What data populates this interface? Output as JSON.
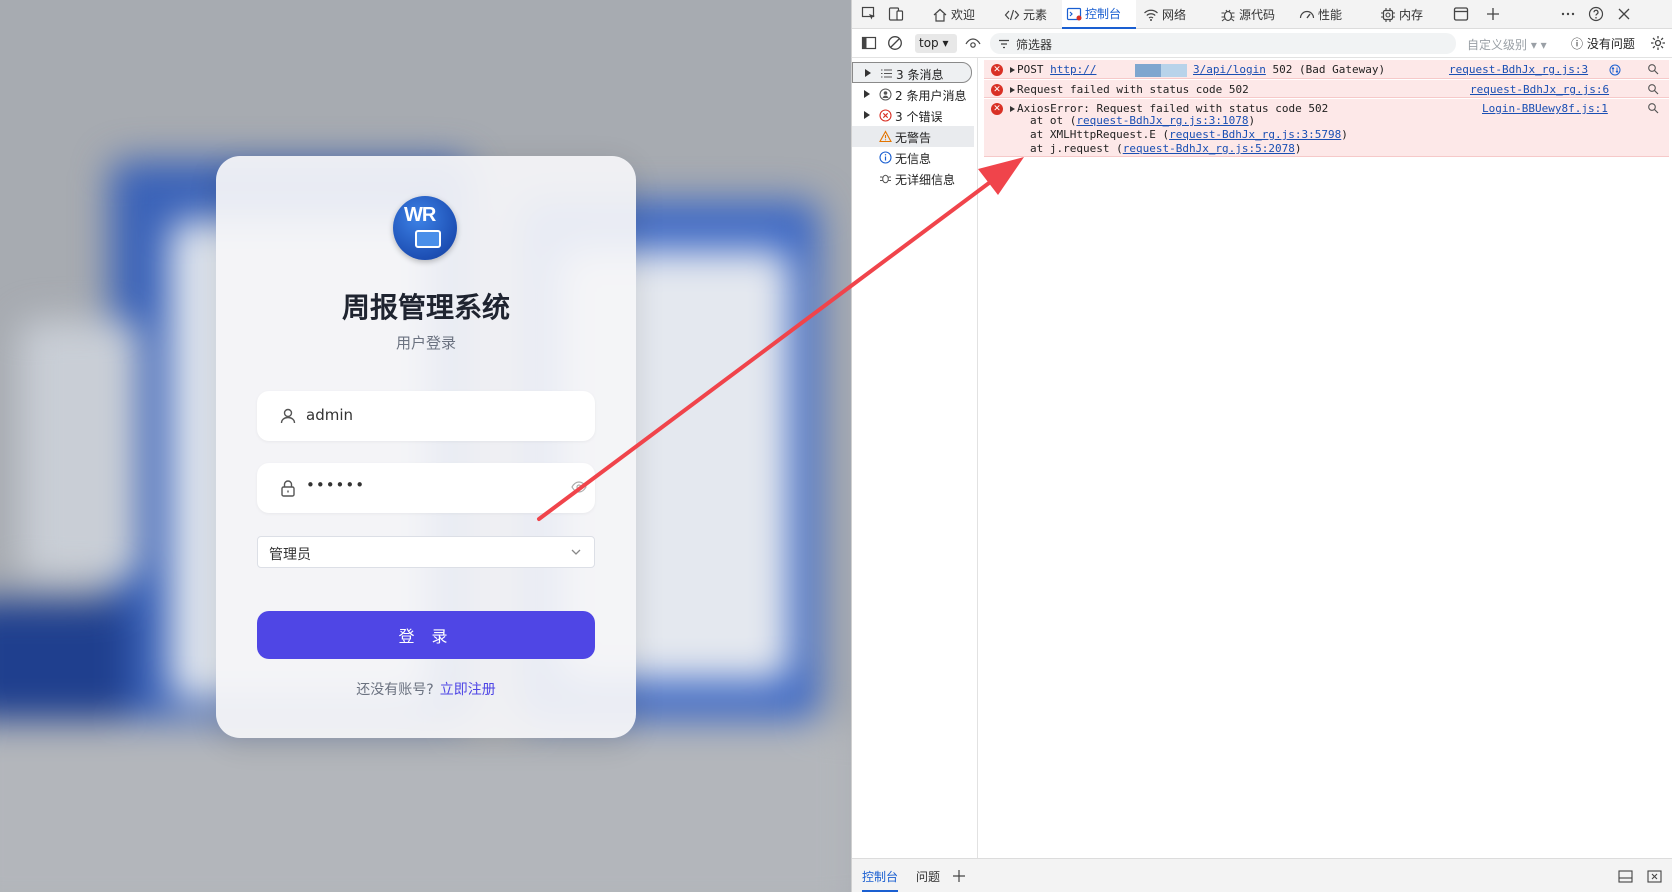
{
  "login": {
    "logo_text": "WR",
    "title": "周报管理系统",
    "subtitle": "用户登录",
    "username_value": "admin",
    "password_value": "••••••",
    "role_value": "管理员",
    "login_button": "登 录",
    "register_prompt": "还没有账号?",
    "register_link": "立即注册"
  },
  "devtools": {
    "tabs": [
      {
        "label": "欢迎",
        "icon": "home-icon"
      },
      {
        "label": "元素",
        "icon": "code-icon"
      },
      {
        "label": "控制台",
        "icon": "console-icon"
      },
      {
        "label": "网络",
        "icon": "wifi-icon"
      },
      {
        "label": "源代码",
        "icon": "bug-icon"
      },
      {
        "label": "性能",
        "icon": "gauge-icon"
      },
      {
        "label": "内存",
        "icon": "chip-icon"
      }
    ],
    "active_tab": "控制台",
    "context": "top",
    "filter_placeholder": "筛选器",
    "levels_label": "自定义级别",
    "issues_label": "没有问题",
    "sidebar": [
      {
        "label": "3 条消息",
        "icon": "list-icon"
      },
      {
        "label": "2 条用户消息",
        "icon": "user-icon"
      },
      {
        "label": "3 个错误",
        "icon": "error-icon"
      },
      {
        "label": "无警告",
        "icon": "warning-icon"
      },
      {
        "label": "无信息",
        "icon": "info-icon"
      },
      {
        "label": "无详细信息",
        "icon": "bug-icon"
      }
    ],
    "messages": [
      {
        "prefix": "POST ",
        "url_start": "http://",
        "url_end": "3/api/login",
        "suffix": " 502 (Bad Gateway)",
        "source": "request-BdhJx_rg.js:3"
      },
      {
        "text": "Request failed with status code 502",
        "source": "request-BdhJx_rg.js:6"
      },
      {
        "text": "AxiosError: Request failed with status code 502",
        "source": "Login-BBUewy8f.js:1",
        "stack": [
          {
            "prefix": "at ot (",
            "link": "request-BdhJx_rg.js:3:1078",
            "suffix": ")"
          },
          {
            "prefix": "at XMLHttpRequest.E (",
            "link": "request-BdhJx_rg.js:3:5798",
            "suffix": ")"
          },
          {
            "prefix": "at j.request (",
            "link": "request-BdhJx_rg.js:5:2078",
            "suffix": ")"
          }
        ]
      }
    ],
    "bottom_tabs": [
      "控制台",
      "问题"
    ]
  },
  "colors": {
    "accent": "#4f46e5",
    "error": "#d93025",
    "annotation_arrow": "#f0444b"
  }
}
